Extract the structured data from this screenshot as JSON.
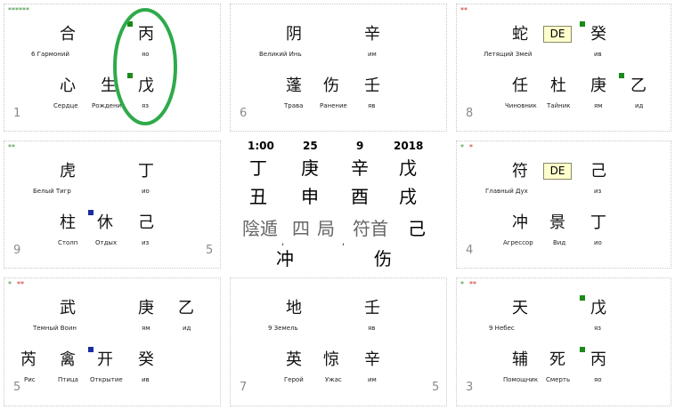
{
  "palaces": [
    {
      "id": "p1",
      "stars": "******",
      "stars_color": "#2e8b2e",
      "number": "1",
      "top_left": "合",
      "top_left_label": "6 Гармоний",
      "top_right": "丙",
      "top_right_label": "яо",
      "bottom_left": "心",
      "bottom_left_label": "Сердце",
      "bottom_mid": "生",
      "bottom_mid_label": "Рождени",
      "bottom_right": "戊",
      "bottom_right_label": "яз"
    },
    {
      "id": "p6",
      "number": "6",
      "top_left": "阴",
      "top_left_label": "Великий Инь",
      "top_right": "辛",
      "top_right_label": "им",
      "bottom_left": "蓬",
      "bottom_left_label": "Трава",
      "bottom_mid": "伤",
      "bottom_mid_label": "Ранение",
      "bottom_right": "壬",
      "bottom_right_label": "яв"
    },
    {
      "id": "p8",
      "stars": "**",
      "stars_color": "#cc2222",
      "number": "8",
      "top_left": "蛇",
      "top_left_label": "Летящий Змей",
      "top_badge": "DE",
      "top_right": "癸",
      "top_right_label": "ив",
      "bottom_left": "任",
      "bottom_left_label": "Чиновник",
      "bottom_mid": "杜",
      "bottom_mid_label": "Тайник",
      "bottom_right": "庚",
      "bottom_right_label": "ям",
      "bottom_extra": "乙",
      "bottom_extra_label": "ид"
    },
    {
      "id": "p9",
      "stars": "**",
      "stars_color": "#2e8b2e",
      "number": "9",
      "number_right": "5",
      "top_left": "虎",
      "top_left_label": "Белый Тигр",
      "top_right": "丁",
      "top_right_label": "ио",
      "bottom_left": "柱",
      "bottom_left_label": "Столп",
      "bottom_mid": "休",
      "bottom_mid_label": "Отдых",
      "bottom_right": "己",
      "bottom_right_label": "из"
    },
    {
      "id": "p4",
      "stars_a": "*",
      "stars_a_color": "#2e8b2e",
      "stars_b": "*",
      "stars_b_color": "#cc2222",
      "number": "4",
      "top_left": "符",
      "top_left_label": "Главный Дух",
      "top_badge": "DE",
      "top_right": "己",
      "top_right_label": "из",
      "bottom_left": "冲",
      "bottom_left_label": "Агрессор",
      "bottom_mid": "景",
      "bottom_mid_label": "Вид",
      "bottom_right": "丁",
      "bottom_right_label": "ио"
    },
    {
      "id": "p5",
      "stars_a": "*",
      "stars_a_color": "#2e8b2e",
      "stars_b": "**",
      "stars_b_color": "#cc2222",
      "number": "5",
      "top_left": "武",
      "top_left_label": "Темный Воин",
      "top_right": "庚",
      "top_right_label": "ям",
      "top_extra": "乙",
      "top_extra_label": "ид",
      "bottom_far": "芮",
      "bottom_far_label": "Рис",
      "bottom_left": "禽",
      "bottom_left_label": "Птица",
      "bottom_mid": "开",
      "bottom_mid_label": "Открытие",
      "bottom_right": "癸",
      "bottom_right_label": "ив"
    },
    {
      "id": "p7",
      "number": "7",
      "number_right": "5",
      "top_left": "地",
      "top_left_label": "9 Земель",
      "top_right": "壬",
      "top_right_label": "яв",
      "bottom_left": "英",
      "bottom_left_label": "Герой",
      "bottom_mid": "惊",
      "bottom_mid_label": "Ужас",
      "bottom_right": "辛",
      "bottom_right_label": "им"
    },
    {
      "id": "p3",
      "stars_a": "*",
      "stars_a_color": "#2e8b2e",
      "stars_b": "**",
      "stars_b_color": "#cc2222",
      "number": "3",
      "top_left": "天",
      "top_left_label": "9 Небес",
      "top_right": "戊",
      "top_right_label": "яз",
      "bottom_left": "辅",
      "bottom_left_label": "Помощник",
      "bottom_mid": "死",
      "bottom_mid_label": "Смерть",
      "bottom_right": "丙",
      "bottom_right_label": "яо"
    }
  ],
  "center": {
    "time": "1:00",
    "day": "25",
    "month": "9",
    "year": "2018",
    "heavenly": [
      "丁",
      "庚",
      "辛",
      "戊"
    ],
    "earthly": [
      "丑",
      "申",
      "酉",
      "戌"
    ],
    "ju": [
      "陰遁",
      "四",
      "局",
      "符首",
      "己"
    ],
    "commas": [
      ",",
      ","
    ],
    "bottom": [
      "冲",
      "伤"
    ]
  },
  "colors": {
    "green_marker": "#1a8a1a",
    "blue_marker": "#1a2ea0",
    "highlight_ring": "#2eaa4a"
  }
}
